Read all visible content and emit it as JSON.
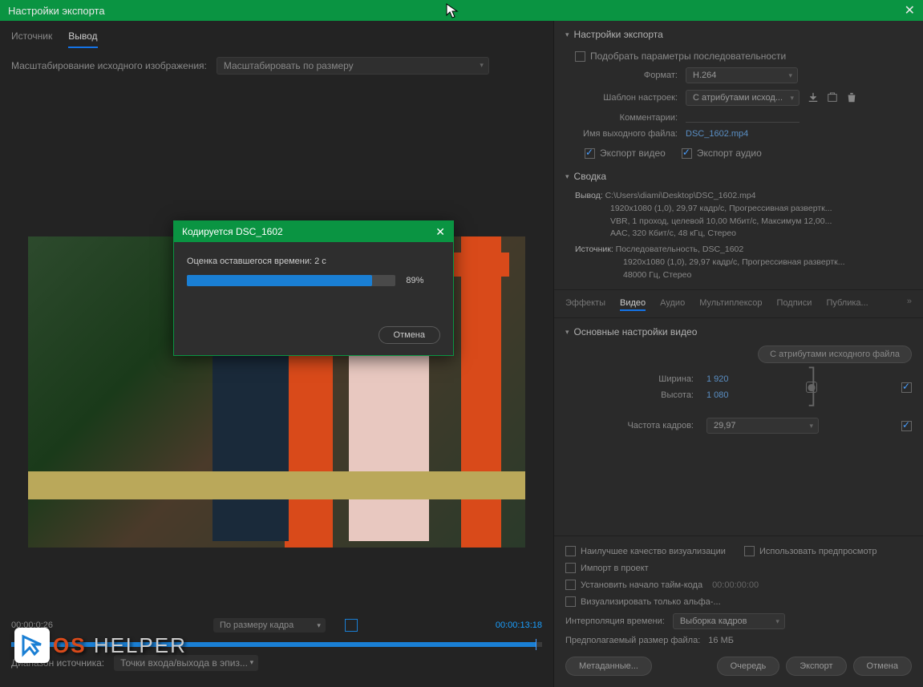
{
  "titlebar": {
    "title": "Настройки экспорта"
  },
  "left": {
    "tabs": {
      "source": "Источник",
      "output": "Вывод"
    },
    "scale_label": "Масштабирование исходного изображения:",
    "scale_value": "Масштабировать по размеру",
    "timecode_left": "00:00:0;26",
    "fit_label": "По размеру кадра",
    "timecode_right": "00:00:13:18",
    "range_label": "Диапазон источника:",
    "range_value": "Точки входа/выхода в эпиз..."
  },
  "progress": {
    "title": "Кодируется DSC_1602",
    "estimate": "Оценка оставшегося времени: 2 с",
    "percent": "89%",
    "cancel": "Отмена"
  },
  "export": {
    "section_title": "Настройки экспорта",
    "match_seq": "Подобрать параметры последовательности",
    "format_label": "Формат:",
    "format_value": "H.264",
    "preset_label": "Шаблон настроек:",
    "preset_value": "С атрибутами исход...",
    "comments_label": "Комментарии:",
    "out_label": "Имя выходного файла:",
    "out_value": "DSC_1602.mp4",
    "export_video": "Экспорт видео",
    "export_audio": "Экспорт аудио",
    "summary_title": "Сводка",
    "summary_out_label": "Вывод:",
    "summary_out_l1": "C:\\Users\\diami\\Desktop\\DSC_1602.mp4",
    "summary_out_l2": "1920x1080 (1,0), 29,97 кадр/с, Прогрессивная развертк...",
    "summary_out_l3": "VBR, 1 проход, целевой 10,00 Мбит/с, Максимум 12,00...",
    "summary_out_l4": "AAC, 320 Кбит/с, 48 кГц, Стерео",
    "summary_src_label": "Источник:",
    "summary_src_l1": "Последовательность, DSC_1602",
    "summary_src_l2": "1920x1080 (1,0), 29,97 кадр/с, Прогрессивная развертк...",
    "summary_src_l3": "48000 Гц, Стерео"
  },
  "subtabs": {
    "effects": "Эффекты",
    "video": "Видео",
    "audio": "Аудио",
    "mux": "Мультиплексор",
    "captions": "Подписи",
    "publish": "Публика..."
  },
  "video_settings": {
    "title": "Основные настройки видео",
    "match_source": "С атрибутами исходного файла",
    "width_label": "Ширина:",
    "width_val": "1 920",
    "height_label": "Высота:",
    "height_val": "1 080",
    "fps_label": "Частота кадров:",
    "fps_val": "29,97"
  },
  "bottom": {
    "max_quality": "Наилучшее качество визуализации",
    "use_previews": "Использовать предпросмотр",
    "import_project": "Импорт в проект",
    "set_tc": "Установить начало тайм-кода",
    "tc_val": "00:00:00:00",
    "render_alpha": "Визуализировать только альфа-...",
    "interp_label": "Интерполяция времени:",
    "interp_val": "Выборка кадров",
    "est_size_label": "Предполагаемый размер файла:",
    "est_size_val": "16 МБ",
    "metadata": "Метаданные...",
    "queue": "Очередь",
    "export_btn": "Экспорт",
    "cancel": "Отмена"
  },
  "watermark": {
    "os": "OS",
    "helper": "HELPER"
  }
}
